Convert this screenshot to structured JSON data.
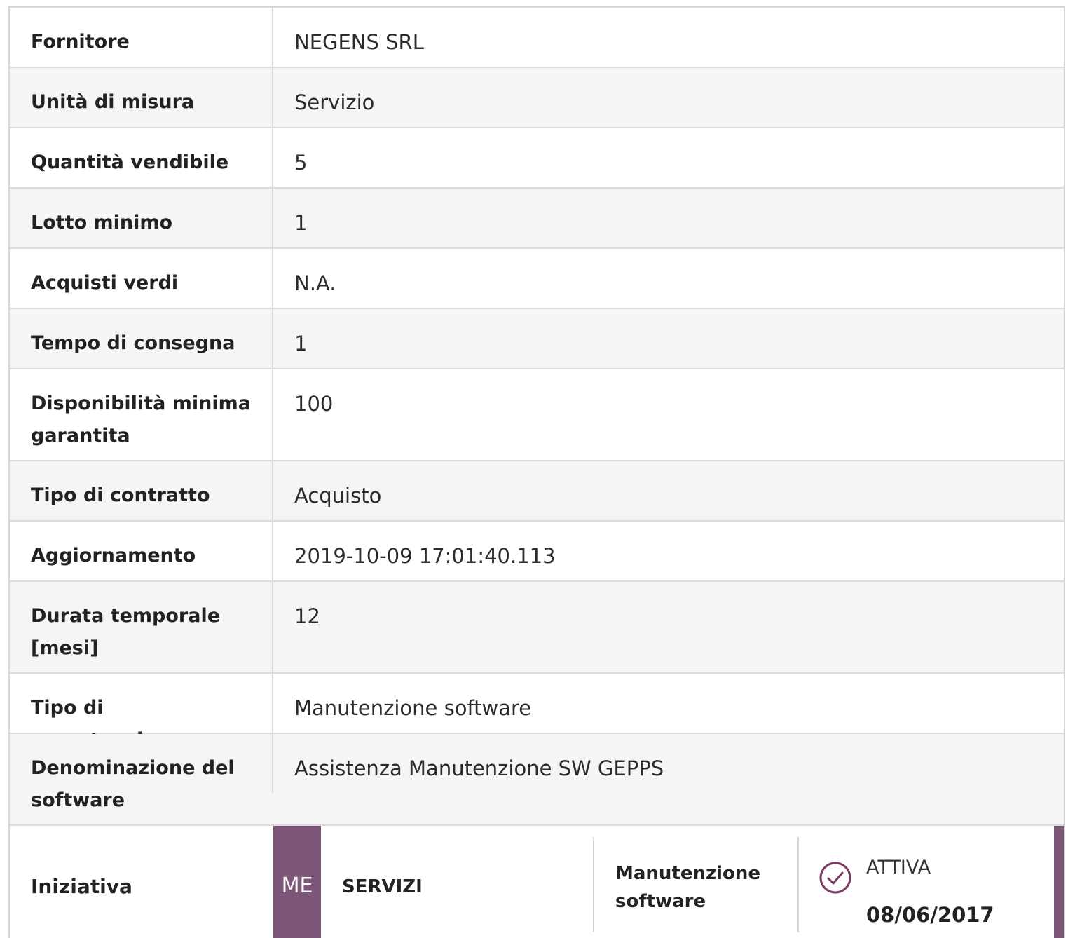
{
  "details": [
    {
      "label": "Fornitore",
      "value": "NEGENS SRL"
    },
    {
      "label": "Unità di misura",
      "value": "Servizio"
    },
    {
      "label": "Quantità vendibile",
      "value": "5"
    },
    {
      "label": "Lotto minimo",
      "value": "1"
    },
    {
      "label": "Acquisti verdi",
      "value": "N.A."
    },
    {
      "label": "Tempo di consegna",
      "value": "1"
    },
    {
      "label": "Disponibilità minima garantita",
      "value": "100"
    },
    {
      "label": "Tipo di contratto",
      "value": "Acquisto"
    },
    {
      "label": "Aggiornamento",
      "value": "2019-10-09 17:01:40.113"
    },
    {
      "label": "Durata temporale [mesi]",
      "value": "12"
    },
    {
      "label": "Tipo di manutenzione",
      "value": "Manutenzione software"
    },
    {
      "label": "Denominazione del software",
      "value": "Assistenza Manutenzione SW GEPPS"
    }
  ],
  "initiative": {
    "label": "Iniziativa",
    "badge": "ME",
    "category": "SERVIZI",
    "type": "Manutenzione software",
    "status_icon": "check-circle-icon",
    "status": "ATTIVA",
    "date": "08/06/2017",
    "accent_color": "#7b5676"
  }
}
